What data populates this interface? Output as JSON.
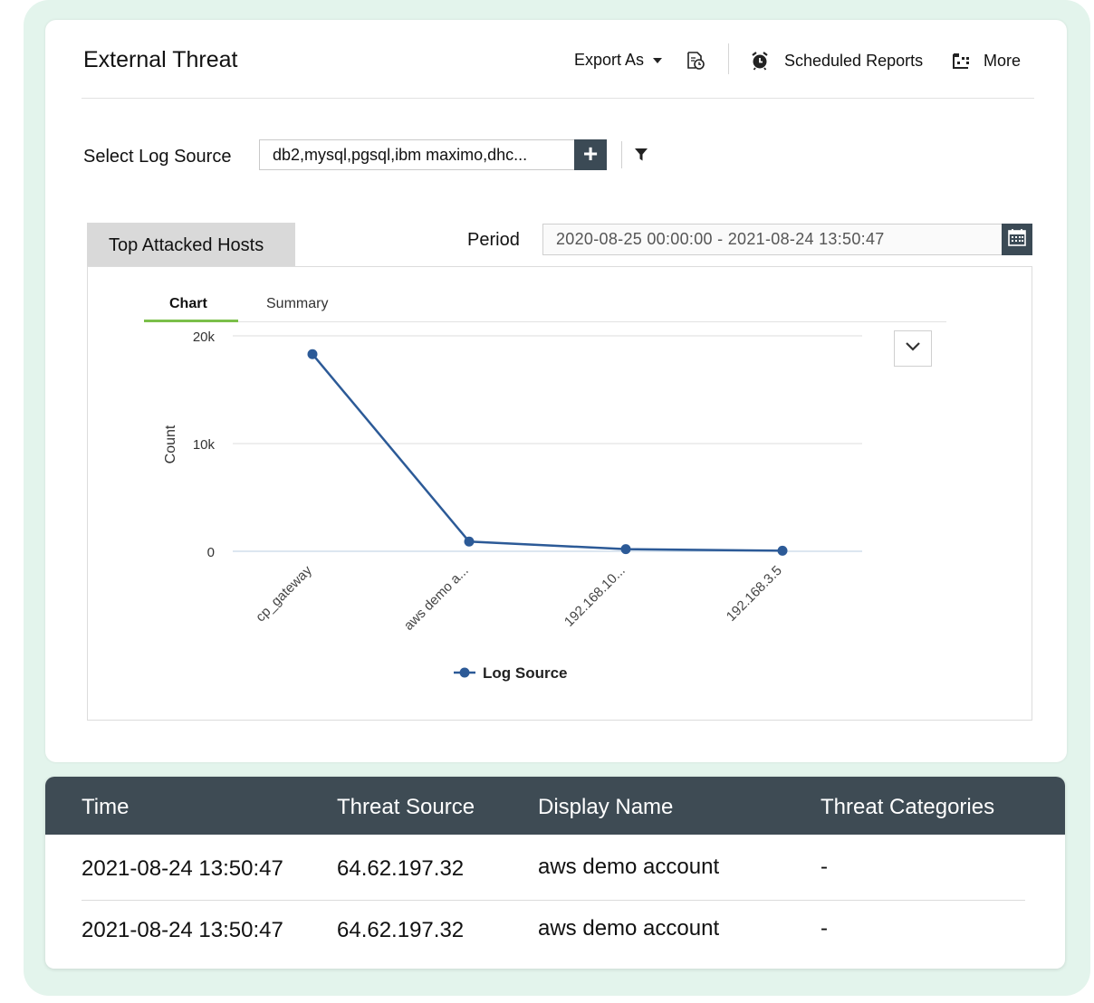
{
  "header": {
    "title": "External Threat",
    "export_label": "Export As",
    "scheduled_label": "Scheduled Reports",
    "more_label": "More"
  },
  "log_source": {
    "label": "Select Log Source",
    "value": "db2,mysql,pgsql,ibm maximo,dhc..."
  },
  "panel": {
    "tab_label": "Top Attacked Hosts",
    "period_label": "Period",
    "period_value": "2020-08-25 00:00:00 - 2021-08-24 13:50:47",
    "tabs": [
      "Chart",
      "Summary"
    ]
  },
  "chart_data": {
    "type": "line",
    "categories": [
      "cp_gateway",
      "aws demo a...",
      "192.168.10...",
      "192.168.3.5"
    ],
    "series": [
      {
        "name": "Log Source",
        "values": [
          18300,
          900,
          200,
          50
        ]
      }
    ],
    "ylabel": "Count",
    "xlabel": "",
    "ylim": [
      0,
      20000
    ],
    "yticks": [
      "20k",
      "10k",
      "0"
    ],
    "color": "#2c5a97",
    "grid": true,
    "legend": "bottom-center"
  },
  "table": {
    "columns": [
      "Time",
      "Threat Source",
      "Display Name",
      "Threat Categories"
    ],
    "rows": [
      [
        "2021-08-24 13:50:47",
        "64.62.197.32",
        "aws demo account",
        "-"
      ],
      [
        "2021-08-24 13:50:47",
        "64.62.197.32",
        "aws demo account",
        "-"
      ]
    ]
  },
  "colors": {
    "dark": "#3b4a55",
    "accent_green": "#7bbf4a",
    "series": "#2c5a97",
    "background_tint": "#e3f4ec"
  }
}
